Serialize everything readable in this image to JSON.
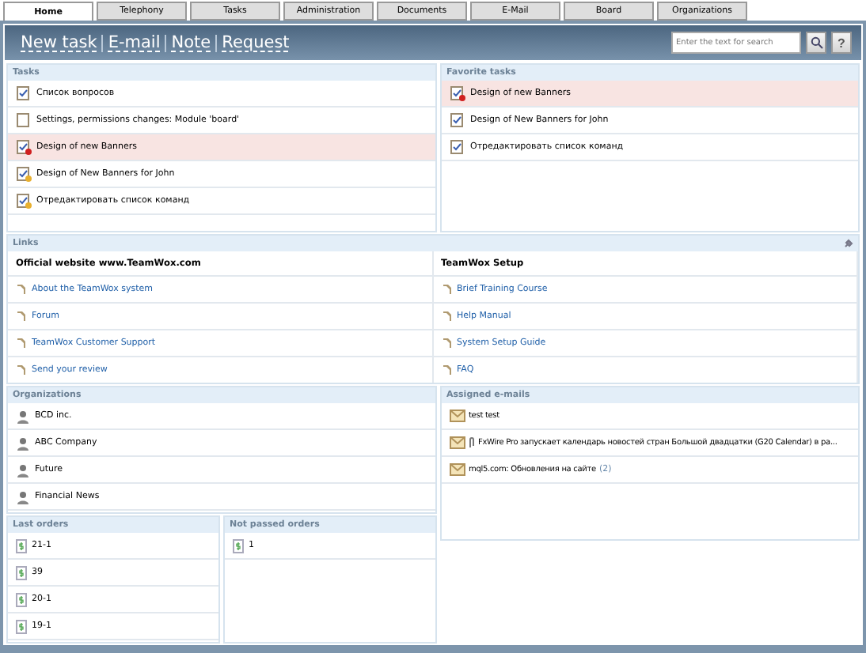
{
  "tabs": [
    {
      "label": "Home",
      "selected": true
    },
    {
      "label": "Telephony",
      "selected": false
    },
    {
      "label": "Tasks",
      "selected": false
    },
    {
      "label": "Administration",
      "selected": false
    },
    {
      "label": "Documents",
      "selected": false
    },
    {
      "label": "E-Mail",
      "selected": false
    },
    {
      "label": "Board",
      "selected": false
    },
    {
      "label": "Organizations",
      "selected": false
    }
  ],
  "toolbar": {
    "actions": [
      "New task",
      "E-mail",
      "Note",
      "Request"
    ],
    "search": {
      "placeholder": "Enter the text for search"
    },
    "help": "?"
  },
  "tasks": {
    "title": "Tasks",
    "items": [
      {
        "text": "Список вопросов",
        "kind": "done"
      },
      {
        "text": "Settings, permissions changes: Module 'board'",
        "kind": "blank"
      },
      {
        "text": "Design of new Banners",
        "kind": "overdue"
      },
      {
        "text": "Design of New Banners for John",
        "kind": "starred"
      },
      {
        "text": "Отредактировать список команд",
        "kind": "starred"
      }
    ]
  },
  "favorite_tasks": {
    "title": "Favorite tasks",
    "items": [
      {
        "text": "Design of new Banners",
        "kind": "overdue"
      },
      {
        "text": "Design of New Banners for John",
        "kind": "done"
      },
      {
        "text": "Отредактировать список команд",
        "kind": "done"
      }
    ]
  },
  "links": {
    "title": "Links",
    "groups": [
      {
        "title": "Official website www.TeamWox.com",
        "items": [
          "About the TeamWox system",
          "Forum",
          "TeamWox Customer Support",
          "Send your review"
        ]
      },
      {
        "title": "TeamWox Setup",
        "items": [
          "Brief Training Course",
          "Help Manual",
          "System Setup Guide",
          "FAQ"
        ]
      }
    ]
  },
  "organizations": {
    "title": "Organizations",
    "items": [
      "BCD inc.",
      "ABC Company",
      "Future",
      "Financial News"
    ]
  },
  "assigned_emails": {
    "title": "Assigned e-mails",
    "items": [
      {
        "subject": "test test",
        "attachment": false
      },
      {
        "subject": "FxWire Pro запускает календарь новостей стран Большой двадцатки (G20 Calendar) в ра...",
        "attachment": true
      },
      {
        "subject": "mql5.com: Обновления на сайте",
        "count": "(2)",
        "attachment": false
      }
    ]
  },
  "last_orders": {
    "title": "Last orders",
    "items": [
      "21-1",
      "39",
      "20-1",
      "19-1"
    ]
  },
  "not_passed_orders": {
    "title": "Not passed orders",
    "items": [
      "1"
    ]
  }
}
